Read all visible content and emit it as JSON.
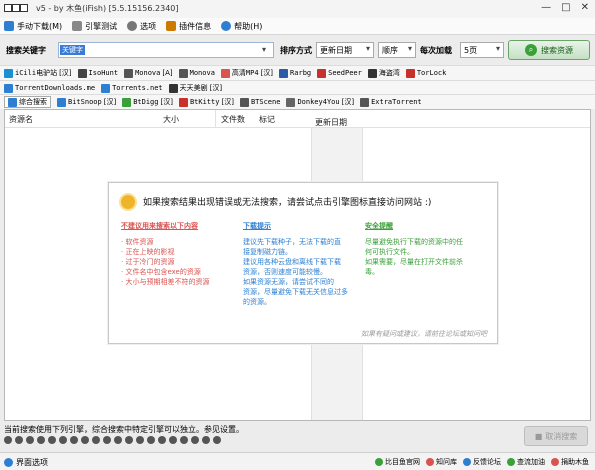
{
  "window": {
    "title": "v5 - by 木鱼(iFish) [5.5.15156.2340]",
    "controls": [
      "—",
      "□",
      "✕"
    ]
  },
  "menu": [
    {
      "label": "手动下载(M)",
      "icon": "download-icon",
      "color": "#2e7fd1"
    },
    {
      "label": "引擎测试",
      "icon": "wrench-icon",
      "color": "#888888"
    },
    {
      "label": "选项",
      "icon": "gear-icon",
      "color": "#777777"
    },
    {
      "label": "插件信息",
      "icon": "puzzle-icon",
      "color": "#cc7a00"
    },
    {
      "label": "帮助(H)",
      "icon": "help-icon",
      "color": "#2e7fd1"
    }
  ],
  "search": {
    "label": "搜索关键字",
    "value": "关键字",
    "sort_label": "排序方式",
    "sort_value": "更新日期",
    "order_value": "顺序",
    "per_page_label": "每次加载",
    "per_page_value": "5页",
    "button_label": "搜索资源"
  },
  "engines_row1": [
    {
      "label": "iCili电驴站",
      "tag": "[汉]",
      "color": "#1a8fd1"
    },
    {
      "label": "IsoHunt",
      "tag": "",
      "color": "#444444"
    },
    {
      "label": "Monova",
      "tag": "[A]",
      "color": "#555555"
    },
    {
      "label": "Monova",
      "tag": "",
      "color": "#555555"
    },
    {
      "label": "高清MP4",
      "tag": "[汉]",
      "color": "#d9534f"
    },
    {
      "label": "Rarbg",
      "tag": "",
      "color": "#2b5aa6"
    },
    {
      "label": "SeedPeer",
      "tag": "",
      "color": "#c9302c"
    },
    {
      "label": "海盗湾",
      "tag": "",
      "color": "#333333"
    },
    {
      "label": "TorLock",
      "tag": "",
      "color": "#c9302c"
    }
  ],
  "engines_row2": [
    {
      "label": "TorrentDownloads.me",
      "tag": "",
      "color": "#2e7fd1"
    },
    {
      "label": "Torrents.net",
      "tag": "",
      "color": "#2e7fd1"
    },
    {
      "label": "天天美剧",
      "tag": "[汉]",
      "color": "#333333"
    }
  ],
  "engines_row3": [
    {
      "label": "综合搜索",
      "tag": "",
      "color": "#2e7fd1",
      "active": true
    },
    {
      "label": "BitSnoop",
      "tag": "[汉]",
      "color": "#2e7fd1"
    },
    {
      "label": "BtDigg",
      "tag": "[汉]",
      "color": "#3aa03a"
    },
    {
      "label": "BtKitty",
      "tag": "[汉]",
      "color": "#c9302c"
    },
    {
      "label": "BTScene",
      "tag": "",
      "color": "#555555"
    },
    {
      "label": "Donkey4You",
      "tag": "[汉]",
      "color": "#666666"
    },
    {
      "label": "ExtraTorrent",
      "tag": "",
      "color": "#555555"
    }
  ],
  "table": {
    "columns": [
      "资源名",
      "大小",
      "文件数",
      "标记",
      "更新日期"
    ]
  },
  "info": {
    "title": "如果搜索结果出现错误或无法搜索，请尝试点击引擎图标直接访问网站 :)",
    "col1_head": "不建议用来搜索以下内容",
    "col1_items": [
      "· 软件资源",
      "· 正在上映的影视",
      "· 过于冷门的资源",
      "· 文件名中包含exe的资源",
      "· 大小与预期相差不符的资源"
    ],
    "col2_head": "下载提示",
    "col2_items": [
      "建议先下载种子，无法下载的直",
      "接复制磁力链。",
      "建议用各种云盘和离线下载下载",
      "资源，否则速度可能较慢。",
      "如果资源无源，请尝试不同的",
      "资源，尽量避免下载无关信息过多",
      "的资源。"
    ],
    "col3_head": "安全提醒",
    "col3_items": [
      "尽量避免执行下载的资源中的任",
      "何可执行文件。",
      "如果需要，尽量在打开文件前杀",
      "毒。"
    ],
    "footer": "如果有疑问或建议，请前往论坛或知问吧"
  },
  "status": {
    "text": "当前搜索使用下列引擎，综合搜索中特定引擎可以独立。参见设置。",
    "stop_label": "取消搜索"
  },
  "footer": {
    "left": "界面选项",
    "links": [
      {
        "label": "比目鱼官网",
        "color": "#3aa03a"
      },
      {
        "label": "知问库",
        "color": "#d9534f"
      },
      {
        "label": "反馈论坛",
        "color": "#2e7fd1"
      },
      {
        "label": "查流加油",
        "color": "#3aa03a"
      },
      {
        "label": "捐助木鱼",
        "color": "#d9534f"
      }
    ]
  },
  "colors": {
    "accent": "#3b7ad8",
    "col1": "#d9534f",
    "col2": "#2e7fd1",
    "col3": "#3aa03a"
  }
}
